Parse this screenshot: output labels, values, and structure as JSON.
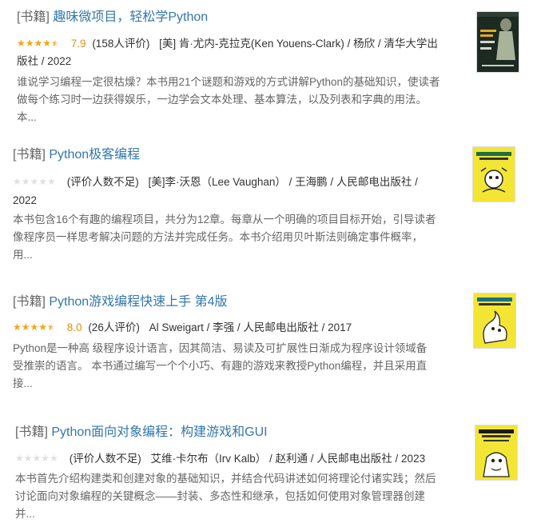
{
  "results": [
    {
      "category": "[书籍]",
      "title": "趣味微项目，轻松学Python",
      "stars": 4,
      "rating": "7.9",
      "count": "(158人评价)",
      "pub_line1": "[美] 肯·尤内-克拉克(Ken Youens-Clark) / 杨欣 / 清华大学出",
      "pub_line2": "版社 / 2022",
      "abstract": [
        "谁说学习编程一定很枯燥？本书用21个谜题和游戏的方式讲解Python的基础知识，使读者",
        "做每个练习时一边获得娱乐，一边学会文本处理、基本算法，以及列表和字典的用法。",
        "本..."
      ],
      "cover": {
        "bg": "#1d2a22",
        "accent": "#e8a51f",
        "text": "趣味微项目 轻松学 Python"
      }
    },
    {
      "category": "[书籍]",
      "title": "Python极客编程",
      "stars": 0,
      "rating": "",
      "count": "(评价人数不足)",
      "pub_line1": "[美]李·沃恩（Lee Vaughan） / 王海鹏 / 人民邮电出版社 /",
      "pub_line2": "2022",
      "abstract": [
        "本书包含16个有趣的编程项目，共分为12章。每章从一个明确的项目目标开始，引导读者",
        "像程序员一样思考解决问题的方法并完成任务。本书介绍用贝叶斯法则确定事件概率，",
        "用..."
      ],
      "cover": {
        "bg": "#f3e534",
        "accent": "#1a6e4a",
        "text": "Python极客编程 用代码探索世界"
      }
    },
    {
      "category": "[书籍]",
      "title": "Python游戏编程快速上手 第4版",
      "stars": 4,
      "rating": "8.0",
      "count": "(26人评价)",
      "pub_line1": "Al Sweigart / 李强 / 人民邮电出版社 / 2017",
      "pub_line2": "",
      "abstract": [
        "Python是一种高 级程序设计语言，因其简洁、易读及可扩展性日渐成为程序设计领域备",
        "受推崇的语言。 本书通过编写一个个小巧、有趣的游戏来教授Python编程，并且采用直",
        "接..."
      ],
      "cover": {
        "bg": "#f3e534",
        "accent": "#1a6e8a",
        "text": "Python游戏编程快速上手"
      }
    },
    {
      "category": "[书籍]",
      "title": "Python面向对象编程：构建游戏和GUI",
      "stars": 0,
      "rating": "",
      "count": "(评价人数不足)",
      "pub_line1": "艾维·卡尔布（Irv Kalb） / 赵利通 / 人民邮电出版社 / 2023",
      "pub_line2": "",
      "abstract": [
        "本书首先介绍构建类和创建对象的基础知识，并结合代码讲述如何将理论付诸实践；然后",
        "讨论面向对象编程的关键概念——封装、多态性和继承，包括如何使用对象管理器创建",
        "并..."
      ],
      "cover": {
        "bg": "#f3e534",
        "accent": "#1a1a1a",
        "text": "Python面向对象编程 构建游戏和GUI"
      }
    }
  ]
}
